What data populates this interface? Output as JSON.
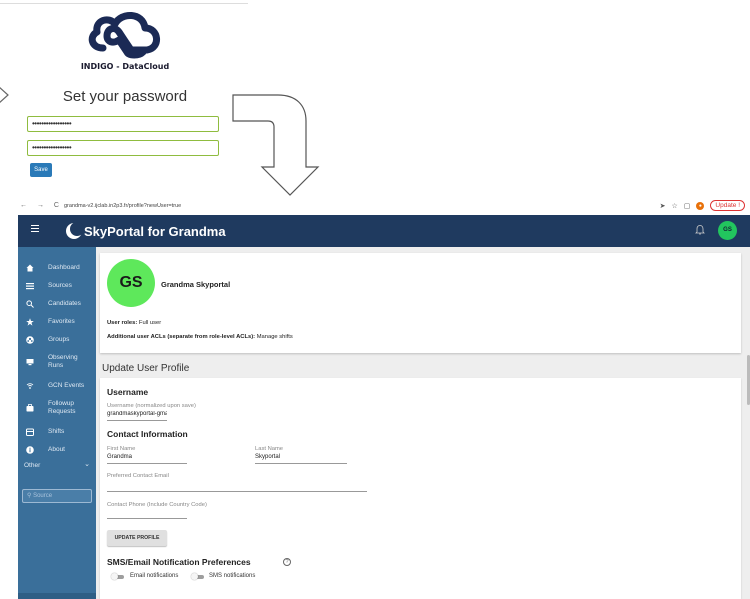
{
  "password_page": {
    "logo_text": "INDIGO - DataCloud",
    "title": "Set your password",
    "password_1": "•••••••••••••••••",
    "password_2": "•••••••••••••••••",
    "save_label": "Save"
  },
  "browser": {
    "nav": "← → C",
    "url": "grandma-v2.ijclab.in2p3.fr/profile?newUser=true",
    "update_label": "Update",
    "update_badge": "!"
  },
  "header": {
    "title": "SkyPortal for Grandma",
    "avatar_initials": "GS",
    "color": "#1f3a5f"
  },
  "sidebar": {
    "items": [
      {
        "label": "Dashboard",
        "icon": "home-icon"
      },
      {
        "label": "Sources",
        "icon": "list-icon"
      },
      {
        "label": "Candidates",
        "icon": "search-icon"
      },
      {
        "label": "Favorites",
        "icon": "star-icon"
      },
      {
        "label": "Groups",
        "icon": "groups-icon"
      },
      {
        "label": "Observing Runs",
        "icon": "telescope-icon"
      },
      {
        "label": "GCN Events",
        "icon": "gcn-icon"
      },
      {
        "label": "Followup Requests",
        "icon": "followup-icon"
      },
      {
        "label": "Shifts",
        "icon": "shifts-icon"
      },
      {
        "label": "About",
        "icon": "info-icon"
      }
    ],
    "other_label": "Other",
    "search_placeholder": "Source",
    "color": "#3a6f9a"
  },
  "profile": {
    "initials": "GS",
    "name": "Grandma Skyportal",
    "roles_label": "User roles:",
    "roles_value": "Full user",
    "acls_label": "Additional user ACLs (separate from role-level ACLs):",
    "acls_value": "Manage shifts"
  },
  "form": {
    "section_title": "Update User Profile",
    "username_heading": "Username",
    "username_label": "Username (normalized upon save)",
    "username_value": "grandmaskyportal-gmail-com",
    "contact_heading": "Contact Information",
    "first_name_label": "First Name",
    "first_name_value": "Grandma",
    "last_name_label": "Last Name",
    "last_name_value": "Skyportal",
    "email_label": "Preferred Contact Email",
    "phone_label": "Contact Phone (Include Country Code)",
    "update_button": "UPDATE PROFILE",
    "notif_heading": "SMS/Email Notification Preferences",
    "email_toggle": "Email notifications",
    "sms_toggle": "SMS notifications"
  }
}
